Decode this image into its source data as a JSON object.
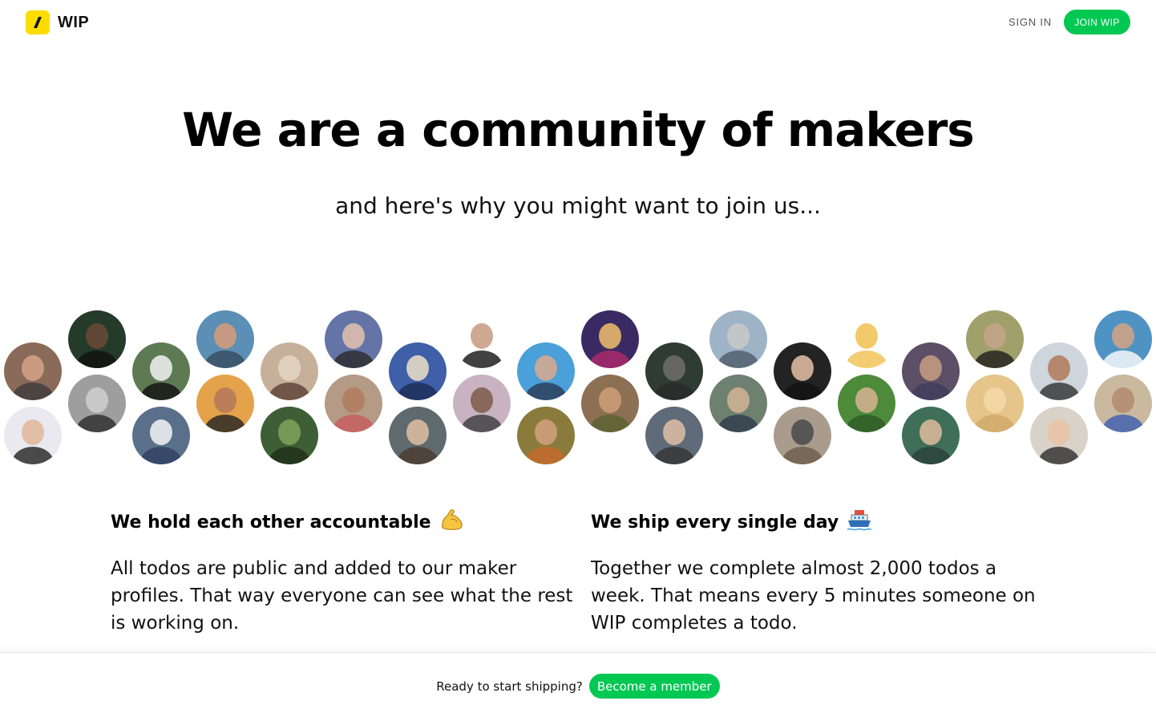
{
  "header": {
    "logo_text": "WIP",
    "signin_label": "SIGN IN",
    "join_label": "JOIN WIP"
  },
  "hero": {
    "title": "We are a community of makers",
    "subtitle": "and here's why you might want to join us..."
  },
  "avatars": [
    {
      "bg": "#8a6a58",
      "face": "#d4a58a",
      "body": "#3b3b3b"
    },
    {
      "bg": "#e9e9ef",
      "face": "#e0b69a",
      "body": "#222"
    },
    {
      "bg": "#243b2a",
      "face": "#6b4a35",
      "body": "#111"
    },
    {
      "bg": "#9e9e9e",
      "face": "#cfcfcf",
      "body": "#2a2a2a"
    },
    {
      "bg": "#5d7a53",
      "face": "#f2f2f2",
      "body": "#111"
    },
    {
      "bg": "#5a6f8a",
      "face": "#f4f4f4",
      "body": "#2e3f63"
    },
    {
      "bg": "#5b8fb5",
      "face": "#d99b7a",
      "body": "#374b5e"
    },
    {
      "bg": "#e4a34a",
      "face": "#b5785a",
      "body": "#222"
    },
    {
      "bg": "#c7b09a",
      "face": "#e6d6c6",
      "body": "#5a4033"
    },
    {
      "bg": "#3e5f36",
      "face": "#7ea55c",
      "body": "#1f2e18"
    },
    {
      "bg": "#6574a6",
      "face": "#e3c2ae",
      "body": "#2b2b2b"
    },
    {
      "bg": "#b59a85",
      "face": "#b07d5f",
      "body": "#c75b5b"
    },
    {
      "bg": "#3f5fa8",
      "face": "#efe1c5",
      "body": "#1d2b54"
    },
    {
      "bg": "#5e6a6e",
      "face": "#e2c0a4",
      "body": "#4a3b2e"
    },
    {
      "bg": "#ffffff",
      "face": "#c69a7e",
      "body": "#111"
    },
    {
      "bg": "#c9b3c2",
      "face": "#7b5a48",
      "body": "#3b3b3b"
    },
    {
      "bg": "#4aa0d9",
      "face": "#d9a98d",
      "body": "#2b3a56"
    },
    {
      "bg": "#8a7b3c",
      "face": "#d2a17e",
      "body": "#c66a2b"
    },
    {
      "bg": "#3a2a63",
      "face": "#f0c06a",
      "body": "#b02b6b"
    },
    {
      "bg": "#8d6f54",
      "face": "#d0a078",
      "body": "#5a6330"
    },
    {
      "bg": "#2f3b33",
      "face": "#6f6f6f",
      "body": "#2a2a2a"
    },
    {
      "bg": "#5f6b78",
      "face": "#e1c0a6",
      "body": "#333"
    },
    {
      "bg": "#9fb3c7",
      "face": "#c9c9c9",
      "body": "#4d5b6b"
    },
    {
      "bg": "#6e8070",
      "face": "#d3b493",
      "body": "#2f3b4f"
    },
    {
      "bg": "#232323",
      "face": "#e6c1a6",
      "body": "#111"
    },
    {
      "bg": "#a99c8d",
      "face": "#4a4a4a",
      "body": "#6b5b4a"
    },
    {
      "bg": "#ffffff",
      "face": "#f1c14f",
      "body": "#f1c14f"
    },
    {
      "bg": "#4d8a3a",
      "face": "#d8b395",
      "body": "#2e5a27"
    },
    {
      "bg": "#5d4f66",
      "face": "#c79d84",
      "body": "#3f3c5c"
    },
    {
      "bg": "#3f6e59",
      "face": "#e0bc9d",
      "body": "#2a4038"
    },
    {
      "bg": "#a0a06a",
      "face": "#c4a389",
      "body": "#1d1d1d"
    },
    {
      "bg": "#e5c58a",
      "face": "#f5d8a8",
      "body": "#cfa868"
    },
    {
      "bg": "#cfd5dc",
      "face": "#b07a5a",
      "body": "#2f2f2f"
    },
    {
      "bg": "#d9d2c8",
      "face": "#e9c3a6",
      "body": "#2d2d2d"
    },
    {
      "bg": "#4f93c4",
      "face": "#d3a382",
      "body": "#ffffff"
    },
    {
      "bg": "#c9b99f",
      "face": "#b38a6f",
      "body": "#3c5db0"
    },
    {
      "bg": "#f2f2f2",
      "face": "#e3c2ab",
      "body": "#dfe8e5"
    },
    {
      "bg": "#5a7f46",
      "face": "#b08563",
      "body": "#1f2d54"
    },
    {
      "bg": "#4a5a6a",
      "face": "#c79c80",
      "body": "#2d2d2d"
    }
  ],
  "features": [
    {
      "title": "We hold each other accountable",
      "emoji": "💪",
      "text": "All todos are public and added to our maker profiles. That way everyone can see what the rest is working on."
    },
    {
      "title": "We ship every single day",
      "emoji": "🚢",
      "text": "Together we complete almost 2,000 todos a week. That means every 5 minutes someone on WIP completes a todo."
    }
  ],
  "footer": {
    "prompt": "Ready to start shipping?",
    "cta_label": "Become a member"
  }
}
